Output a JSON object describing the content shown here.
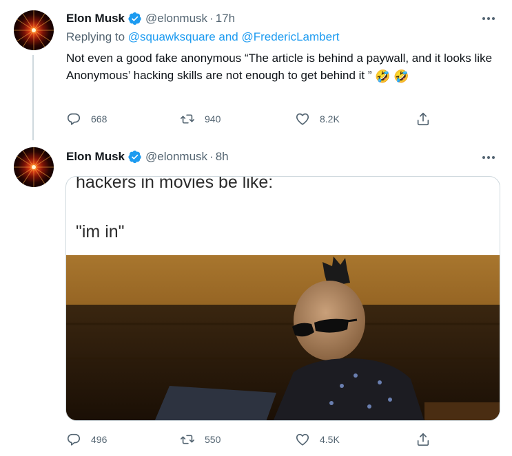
{
  "tweets": [
    {
      "author_name": "Elon Musk",
      "handle": "@elonmusk",
      "separator": "·",
      "time": "17h",
      "replying_prefix": "Replying to ",
      "mention_1": "@squawksquare",
      "and_text": " and ",
      "mention_2": "@FredericLambert",
      "text": "Not even a good fake anonymous “The article is behind a paywall, and it looks like Anonymous’ hacking skills are not enough to get behind it ”",
      "emoji_1": "🤣",
      "emoji_2": "🤣",
      "replies": "668",
      "retweets": "940",
      "likes": "8.2K"
    },
    {
      "author_name": "Elon Musk",
      "handle": "@elonmusk",
      "separator": "·",
      "time": "8h",
      "meme_line_1": "hackers in movies be like:",
      "meme_line_2": "\"im in\"",
      "replies": "496",
      "retweets": "550",
      "likes": "4.5K"
    }
  ],
  "icons": {
    "verified": "verified-badge-icon",
    "more": "more-options-icon",
    "reply": "reply-icon",
    "retweet": "retweet-icon",
    "like": "heart-icon",
    "share": "share-icon"
  },
  "colors": {
    "accent": "#1d9bf0",
    "muted": "#536471",
    "text": "#0f1419",
    "border": "#cfd9de"
  }
}
